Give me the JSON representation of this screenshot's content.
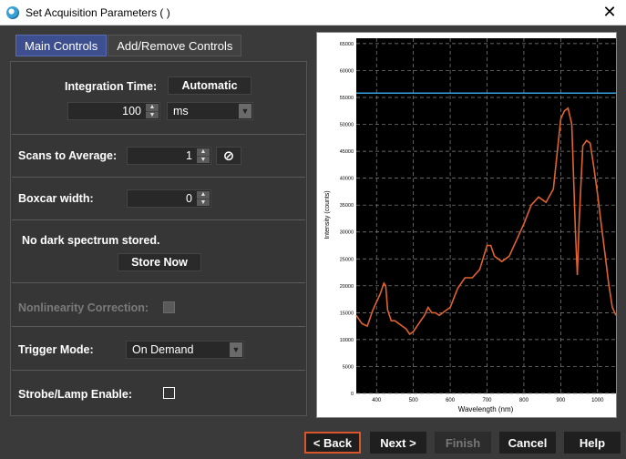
{
  "window": {
    "title": "Set Acquisition Parameters ( )",
    "close_glyph": "✕"
  },
  "tabs": [
    {
      "label": "Main Controls",
      "active": true
    },
    {
      "label": "Add/Remove Controls",
      "active": false
    }
  ],
  "integration": {
    "label": "Integration Time:",
    "mode_button": "Automatic",
    "value": "100",
    "unit": "ms"
  },
  "scans": {
    "label": "Scans to Average:",
    "value": "1"
  },
  "boxcar": {
    "label": "Boxcar width:",
    "value": "0"
  },
  "dark": {
    "status": "No dark spectrum stored.",
    "store_button": "Store Now"
  },
  "nonlinearity": {
    "label": "Nonlinearity Correction:"
  },
  "trigger": {
    "label": "Trigger Mode:",
    "value": "On Demand"
  },
  "strobe": {
    "label": "Strobe/Lamp Enable:"
  },
  "buttons": {
    "back": "< Back",
    "next": "Next >",
    "finish": "Finish",
    "cancel": "Cancel",
    "help": "Help"
  },
  "colors": {
    "tab_active": "#3d4f8f",
    "back_border": "#d9562c",
    "spectrum": "#e0622e",
    "threshold": "#3aa0e0"
  },
  "chart_data": {
    "type": "line",
    "xlabel": "Wavelength (nm)",
    "ylabel": "Intensity (counts)",
    "xlim": [
      345,
      1050
    ],
    "ylim": [
      0,
      66000
    ],
    "x_ticks": [
      400,
      500,
      600,
      700,
      800,
      900,
      1000
    ],
    "y_ticks": [
      0,
      5000,
      10000,
      15000,
      20000,
      25000,
      30000,
      35000,
      40000,
      45000,
      50000,
      55000,
      60000,
      65000
    ],
    "grid": true,
    "threshold": 55800,
    "series": [
      {
        "values_x": [
          345,
          360,
          375,
          390,
          400,
          410,
          420,
          425,
          430,
          440,
          450,
          460,
          470,
          480,
          490,
          500,
          510,
          520,
          530,
          540,
          550,
          560,
          570,
          580,
          590,
          600,
          620,
          640,
          660,
          680,
          700,
          710,
          720,
          740,
          760,
          780,
          800,
          820,
          840,
          860,
          880,
          900,
          910,
          920,
          930,
          940,
          945,
          950,
          960,
          970,
          980,
          990,
          1000,
          1010,
          1020,
          1030,
          1040,
          1050
        ],
        "values_y": [
          14500,
          13000,
          12500,
          15500,
          17000,
          18500,
          20500,
          20000,
          15500,
          13500,
          13500,
          13000,
          12500,
          12000,
          11000,
          11500,
          12500,
          13500,
          14500,
          16000,
          15000,
          15000,
          14500,
          15000,
          15500,
          16000,
          19500,
          21500,
          21500,
          23000,
          27500,
          27500,
          25500,
          24500,
          25500,
          28500,
          31500,
          35000,
          36500,
          35500,
          38000,
          51000,
          52500,
          53000,
          50000,
          30000,
          22000,
          32000,
          46000,
          47000,
          46500,
          42000,
          37000,
          31500,
          26000,
          20500,
          16000,
          14500
        ]
      }
    ]
  }
}
